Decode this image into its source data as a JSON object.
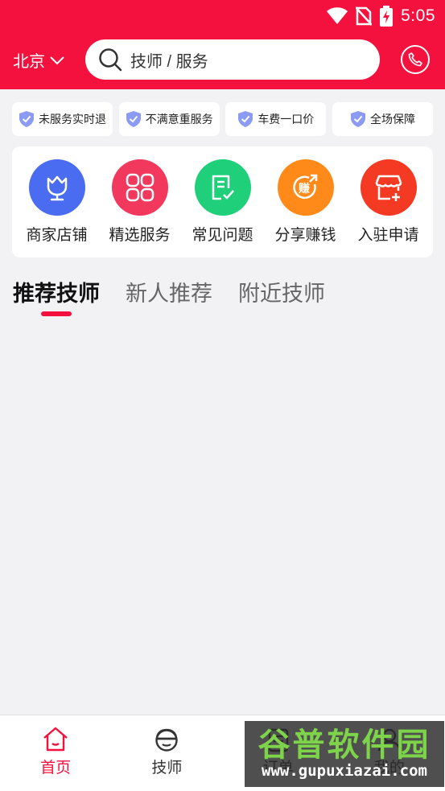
{
  "status_bar": {
    "time": "5:05"
  },
  "header": {
    "city": "北京",
    "search_placeholder": "技师 / 服务"
  },
  "guarantees": [
    {
      "label": "未服务实时退"
    },
    {
      "label": "不满意重服务"
    },
    {
      "label": "车费一口价"
    },
    {
      "label": "全场保障"
    }
  ],
  "services": [
    {
      "label": "商家店铺",
      "icon": "tulip-icon",
      "color": "#4a6cf0"
    },
    {
      "label": "精选服务",
      "icon": "grid-icon",
      "color": "#f2385d"
    },
    {
      "label": "常见问题",
      "icon": "document-check-icon",
      "color": "#1fcf7a"
    },
    {
      "label": "分享赚钱",
      "icon": "earn-icon",
      "color": "#ff8a1a"
    },
    {
      "label": "入驻申请",
      "icon": "store-add-icon",
      "color": "#f53a24"
    }
  ],
  "tabs": [
    {
      "label": "推荐技师",
      "active": true
    },
    {
      "label": "新人推荐",
      "active": false
    },
    {
      "label": "附近技师",
      "active": false
    }
  ],
  "bottom_nav": [
    {
      "label": "首页",
      "icon": "home-icon",
      "active": true
    },
    {
      "label": "技师",
      "icon": "technician-icon",
      "active": false
    },
    {
      "label": "订单",
      "icon": "order-icon",
      "active": false
    },
    {
      "label": "我的",
      "icon": "profile-icon",
      "active": false
    }
  ],
  "watermark": {
    "title": "谷普软件园",
    "url": "www.gupuxiazai.com"
  },
  "colors": {
    "brand": "#f5113e",
    "background": "#f2f2f4"
  }
}
